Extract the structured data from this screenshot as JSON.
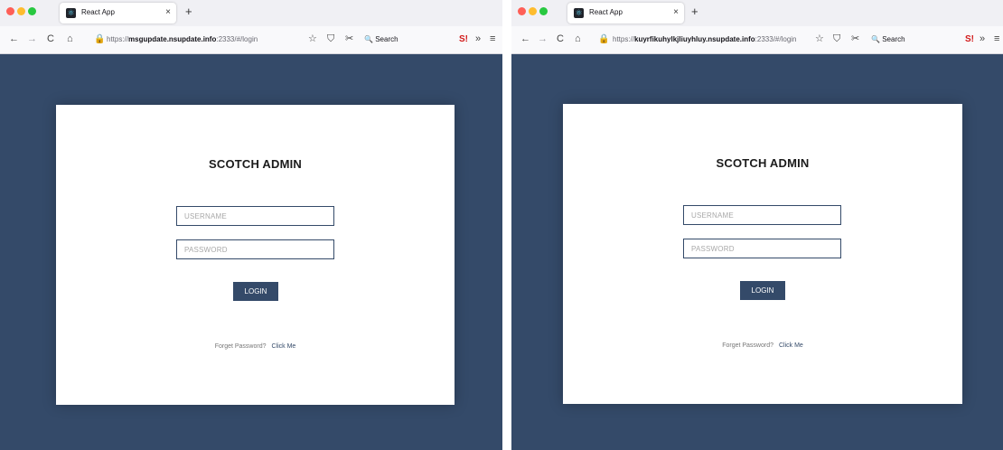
{
  "windows": [
    {
      "tab_title": "React App",
      "tab_close": "×",
      "new_tab": "+",
      "url_prefix": "https://",
      "url_host": "msgupdate.nsupdate.info",
      "url_path": ":2333/#/login",
      "search_label": "Search",
      "heading": "SCOTCH ADMIN",
      "username_placeholder": "USERNAME",
      "password_placeholder": "PASSWORD",
      "login_label": "LOGIN",
      "forgot_text": "Forget Password?",
      "forgot_link": "Click Me"
    },
    {
      "tab_title": "React App",
      "tab_close": "×",
      "new_tab": "+",
      "url_prefix": "https://",
      "url_host": "kuyrfikuhylkjliuyhluy.nsupdate.info",
      "url_path": ":2333/#/login",
      "search_label": "Search",
      "heading": "SCOTCH ADMIN",
      "username_placeholder": "USERNAME",
      "password_placeholder": "PASSWORD",
      "login_label": "LOGIN",
      "forgot_text": "Forget Password?",
      "forgot_link": "Click Me"
    }
  ],
  "icons": {
    "back": "←",
    "forward": "→",
    "reload": "C",
    "home": "⌂",
    "lock": "🔒",
    "bookmark": "☆",
    "shield": "⛉",
    "pocket": "✂",
    "search": "🔍",
    "ext": "S!",
    "overflow": "»",
    "menu": "≡",
    "favicon": "⚛"
  },
  "colors": {
    "page_bg": "#344a69",
    "button_bg": "#344a69",
    "card_bg": "#ffffff",
    "tab_bar": "#f0f0f4"
  }
}
